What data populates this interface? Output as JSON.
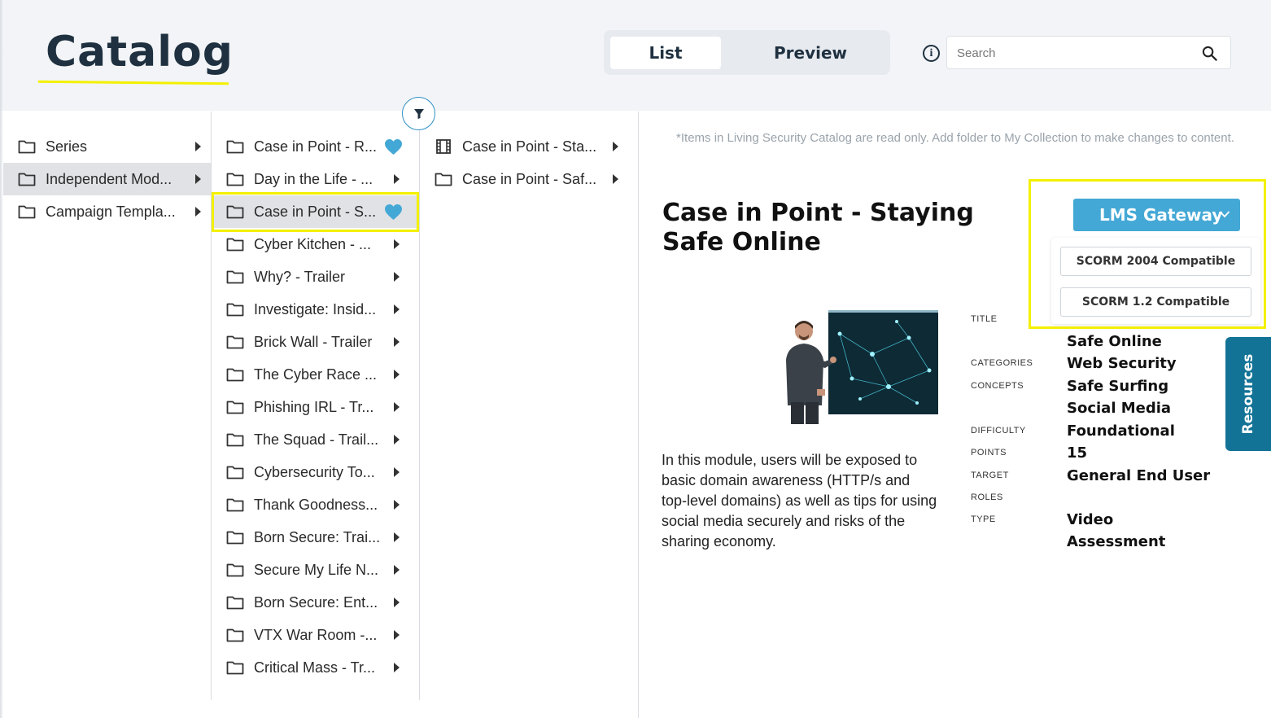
{
  "header": {
    "title": "Catalog",
    "view_toggle": {
      "list_label": "List",
      "preview_label": "Preview",
      "active": "List"
    },
    "search": {
      "placeholder": "Search",
      "value": ""
    }
  },
  "column1": {
    "items": [
      {
        "label": "Series"
      },
      {
        "label": "Independent Mod...",
        "selected": true
      },
      {
        "label": "Campaign Templa..."
      }
    ]
  },
  "column2": {
    "items": [
      {
        "label": "Case in Point - R...",
        "favorite": true
      },
      {
        "label": "Day in the Life - ..."
      },
      {
        "label": "Case in Point - S...",
        "favorite": true,
        "selected": true
      },
      {
        "label": "Cyber Kitchen - ..."
      },
      {
        "label": "Why? - Trailer"
      },
      {
        "label": "Investigate: Insid..."
      },
      {
        "label": "Brick Wall - Trailer"
      },
      {
        "label": "The Cyber Race ..."
      },
      {
        "label": "Phishing IRL - Tr..."
      },
      {
        "label": "The Squad - Trail..."
      },
      {
        "label": "Cybersecurity To..."
      },
      {
        "label": "Thank Goodness..."
      },
      {
        "label": "Born Secure: Trai..."
      },
      {
        "label": "Secure My Life N..."
      },
      {
        "label": "Born Secure: Ent..."
      },
      {
        "label": "VTX War Room -..."
      },
      {
        "label": "Critical Mass - Tr..."
      }
    ]
  },
  "column3": {
    "items": [
      {
        "label": "Case in Point - Sta...",
        "icon": "film-icon"
      },
      {
        "label": "Case in Point - Saf...",
        "icon": "folder-icon"
      }
    ]
  },
  "detail": {
    "notice": "*Items in Living Security Catalog are read only. Add folder to My Collection to make changes to content.",
    "title": "Case in Point - Staying Safe Online",
    "lms_button": "LMS Gateway",
    "lms_options": [
      "SCORM 2004 Compatible",
      "SCORM 1.2 Compatible"
    ],
    "description": "In this module, users will be exposed to basic domain awareness (HTTP/s and top-level domains) as well as tips for using social media securely and risks of the sharing economy.",
    "labels": {
      "title": "TITLE",
      "categories": "CATEGORIES",
      "concepts": "CONCEPTS",
      "difficulty": "DIFFICULTY",
      "points": "POINTS",
      "target": "TARGET",
      "roles": "ROLES",
      "type": "TYPE"
    },
    "values": {
      "title_line": "Safe Online",
      "categories": "Web Security",
      "concepts": [
        "Safe Surfing",
        "Social Media"
      ],
      "difficulty": "Foundational",
      "points": "15",
      "target": "General End User",
      "type": [
        "Video",
        "Assessment"
      ]
    }
  },
  "resources_tab": "Resources",
  "colors": {
    "accent_blue": "#44a8d6",
    "resources_teal": "#137396",
    "highlight_yellow": "#f3f000",
    "heading_navy": "#1f3140"
  }
}
